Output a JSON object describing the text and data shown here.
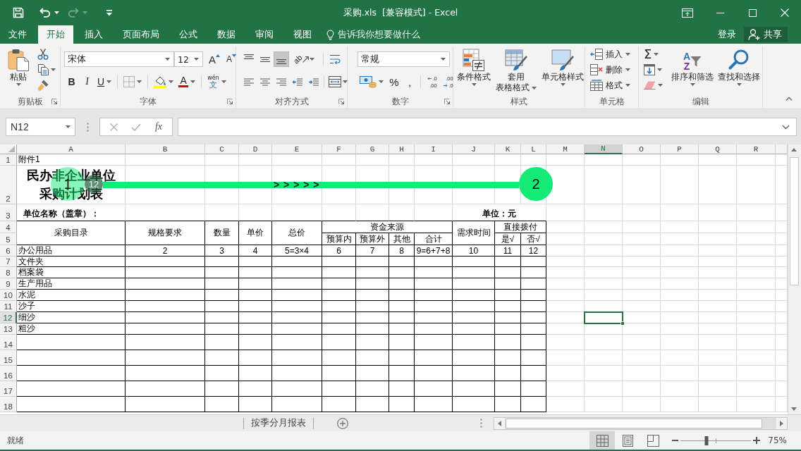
{
  "window": {
    "title": "采购.xls  [兼容模式] - Excel",
    "quick_access": [
      {
        "kind": "save",
        "disabled": false
      },
      {
        "kind": "undo",
        "disabled": false
      },
      {
        "kind": "redo",
        "disabled": true
      },
      {
        "kind": "customize",
        "disabled": false
      }
    ]
  },
  "ribbon_tabs": [
    {
      "label": "文件",
      "selected": false
    },
    {
      "label": "开始",
      "selected": true
    },
    {
      "label": "插入",
      "selected": false
    },
    {
      "label": "页面布局",
      "selected": false
    },
    {
      "label": "公式",
      "selected": false
    },
    {
      "label": "数据",
      "selected": false
    },
    {
      "label": "审阅",
      "selected": false
    },
    {
      "label": "视图",
      "selected": false
    }
  ],
  "tell_me": "告诉我你想要做什么",
  "account": {
    "sign_in": "登录",
    "share": "共享"
  },
  "ribbon": {
    "clipboard": {
      "label": "剪贴板",
      "paste": "粘贴"
    },
    "font": {
      "label": "字体",
      "font_name": "宋体",
      "font_size": "12",
      "glyphs": {
        "grow": "A",
        "shrink": "A",
        "bold": "B",
        "italic": "I",
        "underline": "U",
        "font_color": "A",
        "phonetic": "wén",
        "phonetic_char": "文"
      }
    },
    "alignment": {
      "label": "对齐方式",
      "orientation_glyph": "ab",
      "vertical": [
        {
          "kind": "top",
          "selected": false
        },
        {
          "kind": "middle",
          "selected": false
        },
        {
          "kind": "bottom",
          "selected": true
        }
      ],
      "horizontal": [
        {
          "kind": "left",
          "selected": false
        },
        {
          "kind": "center",
          "selected": false
        },
        {
          "kind": "right",
          "selected": false
        }
      ]
    },
    "number": {
      "label": "数字",
      "format": "常规",
      "percent": "%",
      "comma": ",",
      "decimals": [
        {
          "kind": "increase",
          "top": ".0",
          "bottom": ".00"
        },
        {
          "kind": "decrease",
          "top": ".00",
          "bottom": ".0"
        }
      ]
    },
    "styles": {
      "label": "样式",
      "buttons": [
        {
          "kind": "conditional",
          "label": "条件格式"
        },
        {
          "kind": "table",
          "label": "套用表格格式"
        },
        {
          "kind": "cell",
          "label": "单元格样式"
        }
      ]
    },
    "cells": {
      "label": "单元格",
      "buttons": [
        {
          "kind": "insert",
          "label": "插入"
        },
        {
          "kind": "delete",
          "label": "删除"
        },
        {
          "kind": "format",
          "label": "格式"
        }
      ]
    },
    "editing": {
      "label": "编辑",
      "autosum": "Σ",
      "buttons": [
        {
          "kind": "sort",
          "label": "排序和筛选",
          "glyphs": [
            "A",
            "Z"
          ]
        },
        {
          "kind": "find",
          "label": "查找和选择"
        }
      ]
    }
  },
  "formula_bar": {
    "name_box": "N12",
    "function": "fx"
  },
  "sheet": {
    "columns": [
      {
        "label": "A",
        "selected": false
      },
      {
        "label": "B",
        "selected": false
      },
      {
        "label": "C",
        "selected": false
      },
      {
        "label": "D",
        "selected": false
      },
      {
        "label": "E",
        "selected": false
      },
      {
        "label": "F",
        "selected": false
      },
      {
        "label": "G",
        "selected": false
      },
      {
        "label": "H",
        "selected": false
      },
      {
        "label": "I",
        "selected": false
      },
      {
        "label": "J",
        "selected": false
      },
      {
        "label": "K",
        "selected": false
      },
      {
        "label": "L",
        "selected": false
      },
      {
        "label": "M",
        "selected": false
      },
      {
        "label": "N",
        "selected": true
      },
      {
        "label": "O",
        "selected": false
      },
      {
        "label": "P",
        "selected": false
      },
      {
        "label": "Q",
        "selected": false
      },
      {
        "label": "R",
        "selected": false
      }
    ],
    "rows": [
      {
        "label": "1",
        "selected": false,
        "cells": [
          "附件1"
        ]
      },
      {
        "label": "2",
        "selected": false,
        "cells": [
          "民办非企业单位采购计划表"
        ]
      },
      {
        "label": "3",
        "selected": false,
        "cells": [
          "单位名称（盖章）：",
          null,
          null,
          null,
          null,
          null,
          null,
          null,
          null,
          "单位：元"
        ]
      },
      {
        "label": "4",
        "selected": false,
        "cells": [
          "采购目录",
          "规格要求",
          "数量",
          "单价",
          "总价",
          "资金来源",
          null,
          null,
          null,
          "需求时间",
          "直接拨付"
        ]
      },
      {
        "label": "5",
        "selected": false,
        "cells": [
          null,
          null,
          null,
          null,
          null,
          "预算内",
          "预算外",
          "其他",
          "合计",
          null,
          "是√",
          "否√"
        ]
      },
      {
        "label": "6",
        "selected": false,
        "cells": [
          "办公用品",
          "2",
          "3",
          "4",
          "5=3×4",
          "6",
          "7",
          "8",
          "9=6+7+8",
          "10",
          "11",
          "12"
        ]
      },
      {
        "label": "7",
        "selected": false,
        "cells": [
          "文件夹"
        ]
      },
      {
        "label": "8",
        "selected": false,
        "cells": [
          "档案袋"
        ]
      },
      {
        "label": "9",
        "selected": false,
        "cells": [
          "生产用品"
        ]
      },
      {
        "label": "10",
        "selected": false,
        "cells": [
          "水泥"
        ]
      },
      {
        "label": "11",
        "selected": false,
        "cells": [
          "沙子"
        ]
      },
      {
        "label": "12",
        "selected": true,
        "cells": [
          "细沙"
        ]
      },
      {
        "label": "13",
        "selected": false,
        "cells": [
          "粗沙"
        ]
      },
      {
        "label": "14",
        "selected": false
      },
      {
        "label": "15",
        "selected": false
      },
      {
        "label": "16",
        "selected": false
      },
      {
        "label": "17",
        "selected": false
      },
      {
        "label": "18",
        "selected": false
      }
    ]
  },
  "annotation": {
    "start": "1",
    "badge": "12",
    "arrows": "> > > > >",
    "end": "2"
  },
  "sheet_tabs": [
    {
      "label": "按季分月报表",
      "selected": false
    }
  ],
  "status_bar": {
    "text": "就绪",
    "views": [
      {
        "kind": "normal",
        "selected": true
      },
      {
        "kind": "page_layout",
        "selected": false
      },
      {
        "kind": "page_break",
        "selected": false
      }
    ],
    "zoom": {
      "level": 0.37,
      "reading": "75%"
    }
  }
}
